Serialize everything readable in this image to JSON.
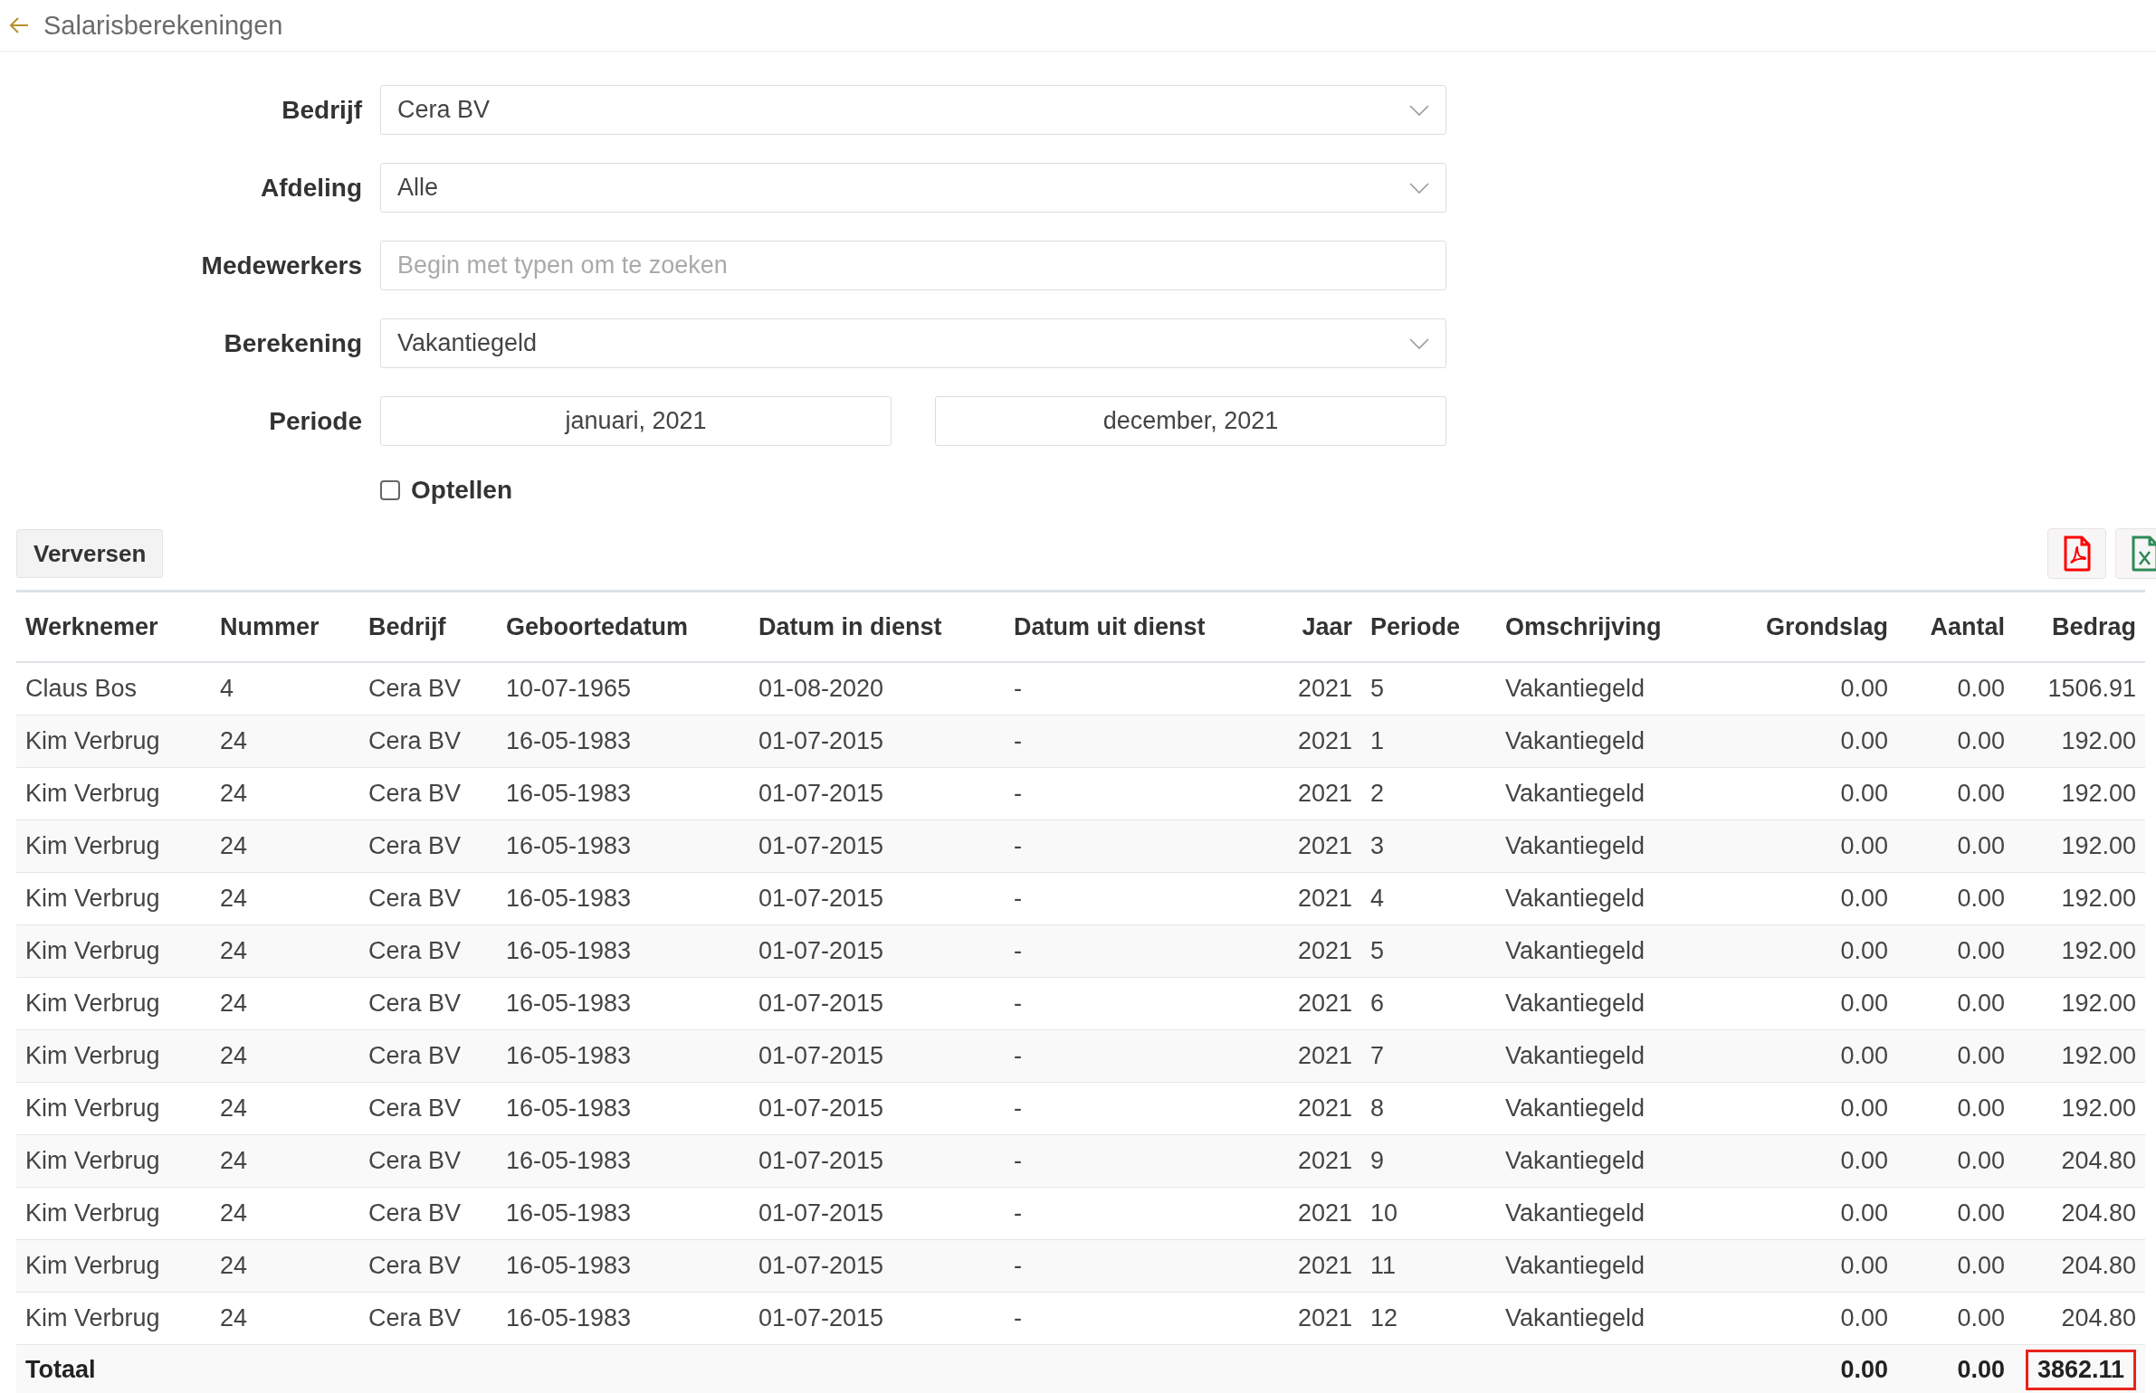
{
  "header": {
    "title": "Salarisberekeningen"
  },
  "form": [
    {
      "kind": "select",
      "label": "Bedrijf",
      "value": "Cera BV"
    },
    {
      "kind": "select",
      "label": "Afdeling",
      "value": "Alle"
    },
    {
      "kind": "text",
      "label": "Medewerkers",
      "placeholder": "Begin met typen om te zoeken"
    },
    {
      "kind": "select",
      "label": "Berekening",
      "value": "Vakantiegeld"
    },
    {
      "kind": "range",
      "label": "Periode",
      "from": "januari, 2021",
      "to": "december, 2021"
    }
  ],
  "checkbox": {
    "label": "Optellen",
    "checked": false
  },
  "toolbar": {
    "refresh": "Verversen"
  },
  "table": {
    "columns": [
      "Werknemer",
      "Nummer",
      "Bedrijf",
      "Geboortedatum",
      "Datum in dienst",
      "Datum uit dienst",
      "Jaar",
      "Periode",
      "Omschrijving",
      "Grondslag",
      "Aantal",
      "Bedrag"
    ],
    "rows": [
      [
        "Claus Bos",
        "4",
        "Cera BV",
        "10-07-1965",
        "01-08-2020",
        "-",
        "2021",
        "5",
        "Vakantiegeld",
        "0.00",
        "0.00",
        "1506.91"
      ],
      [
        "Kim Verbrug",
        "24",
        "Cera BV",
        "16-05-1983",
        "01-07-2015",
        "-",
        "2021",
        "1",
        "Vakantiegeld",
        "0.00",
        "0.00",
        "192.00"
      ],
      [
        "Kim Verbrug",
        "24",
        "Cera BV",
        "16-05-1983",
        "01-07-2015",
        "-",
        "2021",
        "2",
        "Vakantiegeld",
        "0.00",
        "0.00",
        "192.00"
      ],
      [
        "Kim Verbrug",
        "24",
        "Cera BV",
        "16-05-1983",
        "01-07-2015",
        "-",
        "2021",
        "3",
        "Vakantiegeld",
        "0.00",
        "0.00",
        "192.00"
      ],
      [
        "Kim Verbrug",
        "24",
        "Cera BV",
        "16-05-1983",
        "01-07-2015",
        "-",
        "2021",
        "4",
        "Vakantiegeld",
        "0.00",
        "0.00",
        "192.00"
      ],
      [
        "Kim Verbrug",
        "24",
        "Cera BV",
        "16-05-1983",
        "01-07-2015",
        "-",
        "2021",
        "5",
        "Vakantiegeld",
        "0.00",
        "0.00",
        "192.00"
      ],
      [
        "Kim Verbrug",
        "24",
        "Cera BV",
        "16-05-1983",
        "01-07-2015",
        "-",
        "2021",
        "6",
        "Vakantiegeld",
        "0.00",
        "0.00",
        "192.00"
      ],
      [
        "Kim Verbrug",
        "24",
        "Cera BV",
        "16-05-1983",
        "01-07-2015",
        "-",
        "2021",
        "7",
        "Vakantiegeld",
        "0.00",
        "0.00",
        "192.00"
      ],
      [
        "Kim Verbrug",
        "24",
        "Cera BV",
        "16-05-1983",
        "01-07-2015",
        "-",
        "2021",
        "8",
        "Vakantiegeld",
        "0.00",
        "0.00",
        "192.00"
      ],
      [
        "Kim Verbrug",
        "24",
        "Cera BV",
        "16-05-1983",
        "01-07-2015",
        "-",
        "2021",
        "9",
        "Vakantiegeld",
        "0.00",
        "0.00",
        "204.80"
      ],
      [
        "Kim Verbrug",
        "24",
        "Cera BV",
        "16-05-1983",
        "01-07-2015",
        "-",
        "2021",
        "10",
        "Vakantiegeld",
        "0.00",
        "0.00",
        "204.80"
      ],
      [
        "Kim Verbrug",
        "24",
        "Cera BV",
        "16-05-1983",
        "01-07-2015",
        "-",
        "2021",
        "11",
        "Vakantiegeld",
        "0.00",
        "0.00",
        "204.80"
      ],
      [
        "Kim Verbrug",
        "24",
        "Cera BV",
        "16-05-1983",
        "01-07-2015",
        "-",
        "2021",
        "12",
        "Vakantiegeld",
        "0.00",
        "0.00",
        "204.80"
      ]
    ],
    "total": {
      "label": "Totaal",
      "grondslag": "0.00",
      "aantal": "0.00",
      "bedrag": "3862.11",
      "highlighted": true
    }
  }
}
